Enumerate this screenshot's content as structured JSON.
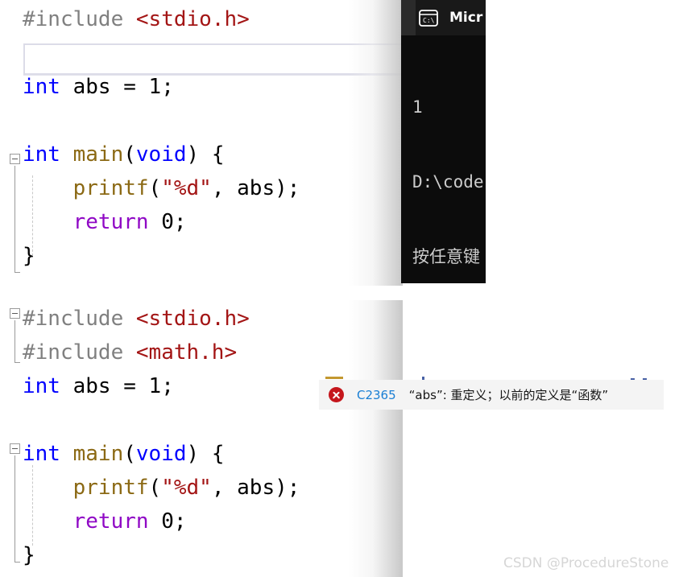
{
  "editor_top": {
    "lines": [
      {
        "tokens": [
          {
            "t": "#include ",
            "c": "pre"
          },
          {
            "t": "<stdio.h>",
            "c": "hdr"
          }
        ]
      },
      {
        "tokens": []
      },
      {
        "tokens": [
          {
            "t": "int",
            "c": "kw"
          },
          {
            "t": " abs = 1;",
            "c": "plain"
          }
        ]
      },
      {
        "tokens": []
      },
      {
        "tokens": [
          {
            "t": "int",
            "c": "kw"
          },
          {
            "t": " ",
            "c": "plain"
          },
          {
            "t": "main",
            "c": "fn"
          },
          {
            "t": "(",
            "c": "plain"
          },
          {
            "t": "void",
            "c": "kw"
          },
          {
            "t": ") {",
            "c": "plain"
          }
        ]
      },
      {
        "tokens": [
          {
            "t": "    ",
            "c": "plain"
          },
          {
            "t": "printf",
            "c": "fn"
          },
          {
            "t": "(",
            "c": "plain"
          },
          {
            "t": "\"%d\"",
            "c": "str"
          },
          {
            "t": ", abs);",
            "c": "plain"
          }
        ]
      },
      {
        "tokens": [
          {
            "t": "    ",
            "c": "plain"
          },
          {
            "t": "return",
            "c": "ctl"
          },
          {
            "t": " 0;",
            "c": "plain"
          }
        ]
      },
      {
        "tokens": [
          {
            "t": "}",
            "c": "plain"
          }
        ]
      }
    ]
  },
  "editor_bottom": {
    "lines": [
      {
        "tokens": [
          {
            "t": "#include ",
            "c": "pre"
          },
          {
            "t": "<stdio.h>",
            "c": "hdr"
          }
        ]
      },
      {
        "tokens": [
          {
            "t": "#include ",
            "c": "pre"
          },
          {
            "t": "<math.h>",
            "c": "hdr"
          }
        ]
      },
      {
        "tokens": [
          {
            "t": "int",
            "c": "kw"
          },
          {
            "t": " abs = 1;",
            "c": "plain"
          }
        ]
      },
      {
        "tokens": []
      },
      {
        "tokens": [
          {
            "t": "int",
            "c": "kw"
          },
          {
            "t": " ",
            "c": "plain"
          },
          {
            "t": "main",
            "c": "fn"
          },
          {
            "t": "(",
            "c": "plain"
          },
          {
            "t": "void",
            "c": "kw"
          },
          {
            "t": ") {",
            "c": "plain"
          }
        ]
      },
      {
        "tokens": [
          {
            "t": "    ",
            "c": "plain"
          },
          {
            "t": "printf",
            "c": "fn"
          },
          {
            "t": "(",
            "c": "plain"
          },
          {
            "t": "\"%d\"",
            "c": "str"
          },
          {
            "t": ", abs);",
            "c": "plain"
          }
        ]
      },
      {
        "tokens": [
          {
            "t": "    ",
            "c": "plain"
          },
          {
            "t": "return",
            "c": "ctl"
          },
          {
            "t": " 0;",
            "c": "plain"
          }
        ]
      },
      {
        "tokens": [
          {
            "t": "}",
            "c": "plain"
          }
        ]
      }
    ]
  },
  "textbox": {
    "value": "",
    "placeholder": ""
  },
  "console": {
    "icon": "console-cmd-icon",
    "title": "Micr",
    "lines": [
      "1",
      "D:\\code",
      "按任意键"
    ]
  },
  "error_tooltip": {
    "icon": "error-circle-icon",
    "code": "C2365",
    "message": "“abs”: 重定义；以前的定义是“函数”"
  },
  "watermark": {
    "text": "CSDN @ProcedureStone"
  },
  "colors": {
    "keyword": "#0000FF",
    "preprocessor": "#808080",
    "header": "#A31515",
    "string": "#A31515",
    "control": "#8F08C5",
    "function": "#8B6914",
    "error_red": "#C5161C",
    "error_code_blue": "#1A7FD4",
    "console_bg": "#0C0C0C",
    "tooltip_bg": "#F4F4F4"
  }
}
